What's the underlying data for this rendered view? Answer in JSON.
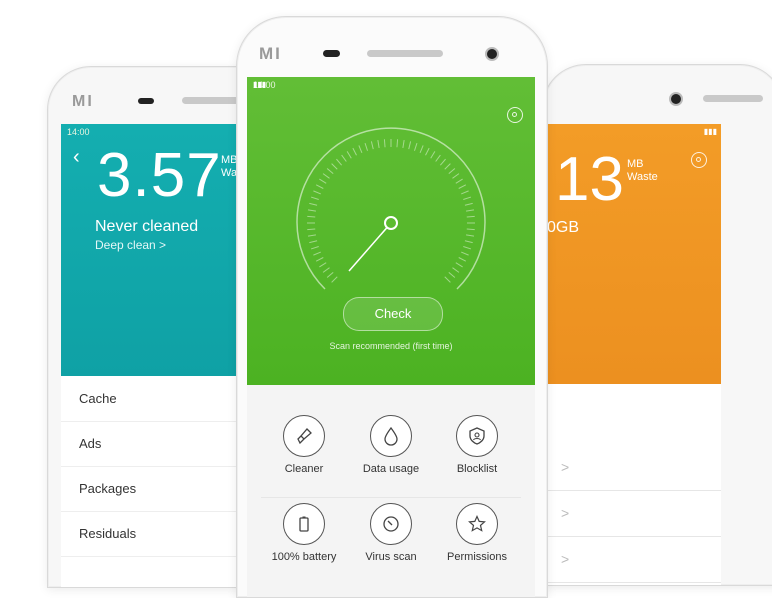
{
  "left_phone": {
    "brand": "MI",
    "time": "14:00",
    "big_number": "3.57",
    "unit_line1": "MB",
    "unit_line2": "Waste",
    "headline": "Never cleaned",
    "subline": "Deep clean >",
    "list": [
      "Cache",
      "Ads",
      "Packages",
      "Residuals"
    ]
  },
  "right_phone": {
    "big_number": "13",
    "unit_line1": "MB",
    "unit_line2": "Waste",
    "sub": "0GB",
    "chevron": ">"
  },
  "center_phone": {
    "brand": "MI",
    "time": "14:00",
    "check_label": "Check",
    "scan_hint": "Scan recommended (first time)",
    "tools": [
      {
        "label": "Cleaner",
        "icon": "brush-icon"
      },
      {
        "label": "Data usage",
        "icon": "drop-icon"
      },
      {
        "label": "Blocklist",
        "icon": "shield-user-icon"
      },
      {
        "label": "100% battery",
        "icon": "battery-icon"
      },
      {
        "label": "Virus scan",
        "icon": "clock-icon"
      },
      {
        "label": "Permissions",
        "icon": "star-icon"
      }
    ]
  },
  "colors": {
    "teal": "#14aeb0",
    "green": "#55b629",
    "orange": "#f0952a"
  }
}
